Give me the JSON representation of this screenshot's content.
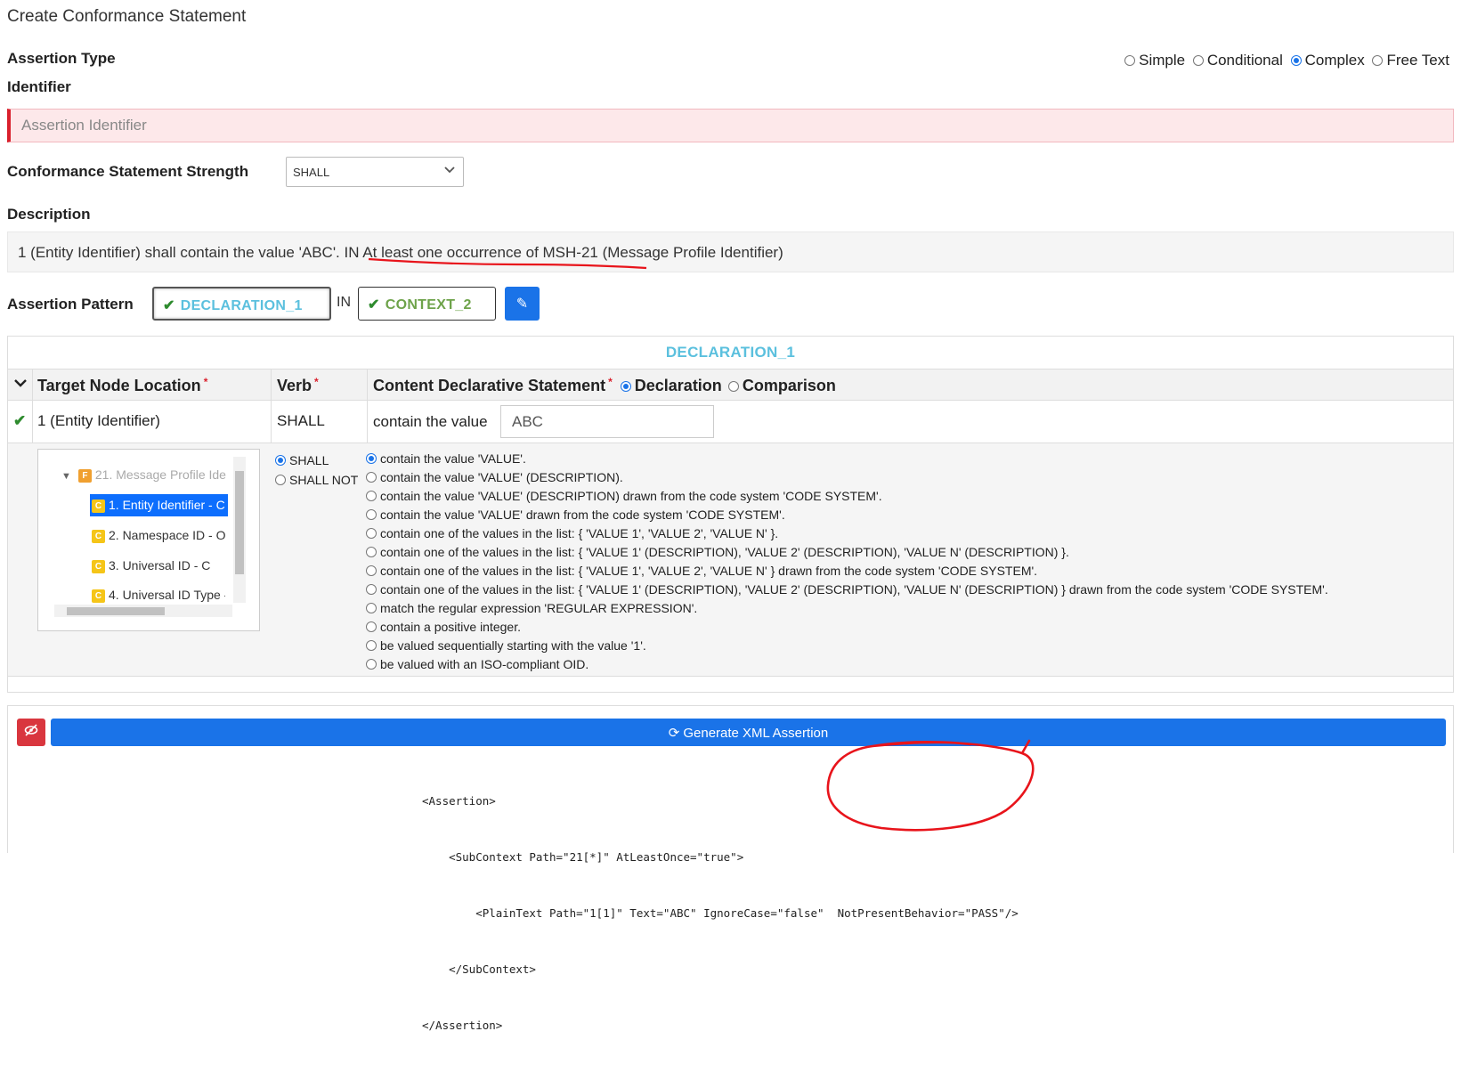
{
  "page": {
    "title": "Create Conformance Statement"
  },
  "assertion_type": {
    "label": "Assertion Type",
    "options": [
      "Simple",
      "Conditional",
      "Complex",
      "Free Text"
    ],
    "selected": "Complex"
  },
  "identifier": {
    "label": "Identifier",
    "placeholder": "Assertion Identifier",
    "value": ""
  },
  "strength": {
    "label": "Conformance Statement Strength",
    "value": "SHALL"
  },
  "description": {
    "label": "Description",
    "text_part1": "1 (Entity Identifier) shall contain the value 'ABC'.",
    "text_part2": "IN At least one occurrence of MSH-21",
    "text_part3": "(Message Profile Identifier)"
  },
  "pattern": {
    "label": "Assertion Pattern",
    "declaration_label": "DECLARATION_1",
    "connector": "IN",
    "context_label": "CONTEXT_2"
  },
  "declaration_panel": {
    "title": "DECLARATION_1",
    "headers": {
      "target": "Target Node Location",
      "verb": "Verb",
      "content": "Content Declarative Statement",
      "mode_options": [
        "Declaration",
        "Comparison"
      ],
      "mode_selected": "Declaration"
    },
    "row": {
      "target": "1 (Entity Identifier)",
      "verb": "SHALL",
      "statement": "contain the value",
      "value": "ABC"
    },
    "tree": {
      "items": [
        {
          "badge": "F",
          "label": "21. Message Profile Ide"
        },
        {
          "badge": "C",
          "label": "1. Entity Identifier - C"
        },
        {
          "badge": "C",
          "label": "2. Namespace ID - O"
        },
        {
          "badge": "C",
          "label": "3. Universal ID - C"
        },
        {
          "badge": "C",
          "label": "4. Universal ID Type -"
        }
      ]
    },
    "verb_options": [
      "SHALL",
      "SHALL NOT"
    ],
    "verb_selected": "SHALL",
    "statement_options": [
      "contain the value 'VALUE'.",
      "contain the value 'VALUE' (DESCRIPTION).",
      "contain the value 'VALUE' (DESCRIPTION) drawn from the code system 'CODE SYSTEM'.",
      "contain the value 'VALUE' drawn from the code system 'CODE SYSTEM'.",
      "contain one of the values in the list: { 'VALUE 1', 'VALUE 2', 'VALUE N' }.",
      "contain one of the values in the list: { 'VALUE 1' (DESCRIPTION), 'VALUE 2' (DESCRIPTION), 'VALUE N' (DESCRIPTION) }.",
      "contain one of the values in the list: { 'VALUE 1', 'VALUE 2', 'VALUE N' } drawn from the code system 'CODE SYSTEM'.",
      "contain one of the values in the list: { 'VALUE 1' (DESCRIPTION), 'VALUE 2' (DESCRIPTION), 'VALUE N' (DESCRIPTION) } drawn from the code system 'CODE SYSTEM'.",
      "match the regular expression 'REGULAR EXPRESSION'.",
      "contain a positive integer.",
      "be valued sequentially starting with the value '1'.",
      "be valued with an ISO-compliant OID."
    ],
    "statement_selected_index": 0
  },
  "xml_panel": {
    "generate_label": "Generate XML Assertion",
    "code_lines": [
      "<Assertion>",
      "    <SubContext Path=\"21[*]\" AtLeastOnce=\"true\">",
      "        <PlainText Path=\"1[1]\" Text=\"ABC\" IgnoreCase=\"false\"  NotPresentBehavior=\"PASS\"/>",
      "    </SubContext>",
      "</Assertion>"
    ]
  },
  "colors": {
    "primary": "#1a73e8",
    "danger": "#d9363e",
    "declaration": "#5bc0de",
    "context": "#6ea34a",
    "annotation": "#e8141b"
  }
}
